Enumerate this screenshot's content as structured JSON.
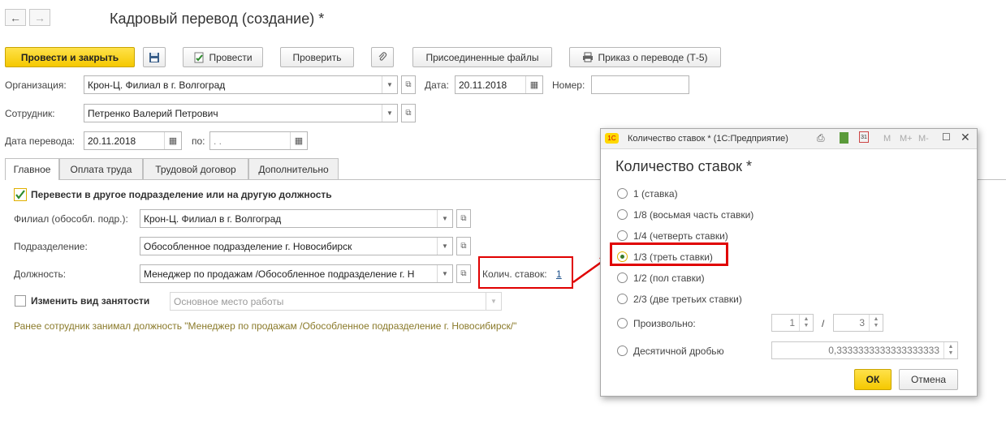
{
  "window": {
    "title": "Кадровый перевод (создание) *"
  },
  "nav": {
    "back": "←",
    "forward": "→"
  },
  "toolbar": {
    "post_close": "Провести и закрыть",
    "post": "Провести",
    "check": "Проверить",
    "attached_files": "Присоединенные файлы",
    "order": "Приказ о переводе (Т-5)"
  },
  "header": {
    "org_label": "Организация:",
    "org_value": "Крон-Ц. Филиал в г. Волгоград",
    "date_label": "Дата:",
    "date_value": "20.11.2018",
    "number_label": "Номер:",
    "number_value": "",
    "employee_label": "Сотрудник:",
    "employee_value": "Петренко Валерий Петрович",
    "transfer_date_label": "Дата перевода:",
    "transfer_date_value": "20.11.2018",
    "to_label": "по:",
    "to_value": " .  ."
  },
  "tabs": [
    {
      "label": "Главное"
    },
    {
      "label": "Оплата труда"
    },
    {
      "label": "Трудовой договор"
    },
    {
      "label": "Дополнительно"
    }
  ],
  "main": {
    "transfer_checkbox_label": "Перевести в другое подразделение или на другую должность",
    "branch_label": "Филиал (обособл. подр.):",
    "branch_value": "Крон-Ц. Филиал в г. Волгоград",
    "division_label": "Подразделение:",
    "division_value": "Обособленное подразделение г. Новосибирск",
    "position_label": "Должность:",
    "position_value": "Менеджер по продажам /Обособленное подразделение г. Н",
    "rates_label": "Колич. ставок:",
    "rates_value": "1",
    "change_employment_label": "Изменить вид занятости",
    "employment_value": "Основное место работы",
    "previous_note": "Ранее сотрудник занимал должность \"Менеджер по продажам /Обособленное подразделение г. Новосибирск/\""
  },
  "dialog": {
    "window_title": "Количество ставок * (1С:Предприятие)",
    "app_badge": "1С",
    "tool_m": "M",
    "tool_mplus": "M+",
    "tool_mminus": "M-",
    "heading": "Количество ставок *",
    "options": [
      {
        "label": "1 (ставка)",
        "selected": false
      },
      {
        "label": "1/8 (восьмая часть ставки)",
        "selected": false
      },
      {
        "label": "1/4 (четверть ставки)",
        "selected": false
      },
      {
        "label": "1/3 (треть ставки)",
        "selected": true
      },
      {
        "label": "1/2 (пол ставки)",
        "selected": false
      },
      {
        "label": "2/3 (две третьих ставки)",
        "selected": false
      }
    ],
    "custom_label": "Произвольно:",
    "numerator": "1",
    "separator": "/",
    "denominator": "3",
    "decimal_label": "Десятичной дробью",
    "decimal_value": "0,3333333333333333333",
    "ok": "ОК",
    "cancel": "Отмена"
  },
  "colors": {
    "accent": "#f5c800",
    "highlight": "#e00000",
    "link": "#1a4f8a",
    "note": "#8a7a2a"
  }
}
